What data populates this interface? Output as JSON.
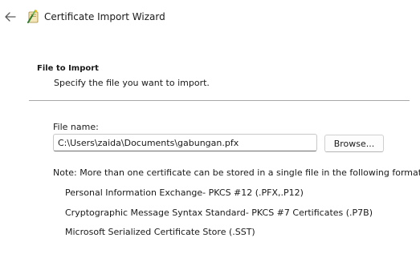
{
  "window": {
    "title": "Certificate Import Wizard",
    "back_icon": "back-arrow-icon",
    "app_icon": "certificate-wizard-icon"
  },
  "section": {
    "title": "File to Import",
    "subtitle": "Specify the file you want to import."
  },
  "file_name": {
    "label": "File name:",
    "value": "C:\\Users\\zaida\\Documents\\gabungan.pfx"
  },
  "browse_button": {
    "label": "Browse..."
  },
  "note": {
    "text": "Note:  More than one certificate can be stored in a single file in the following formats:",
    "formats": [
      "Personal Information Exchange- PKCS #12 (.PFX,.P12)",
      "Cryptographic Message Syntax Standard- PKCS #7 Certificates (.P7B)",
      "Microsoft Serialized Certificate Store (.SST)"
    ]
  },
  "colors": {
    "background": "#ffffff",
    "text": "#1a1a1a",
    "divider": "#a8a8a8"
  }
}
